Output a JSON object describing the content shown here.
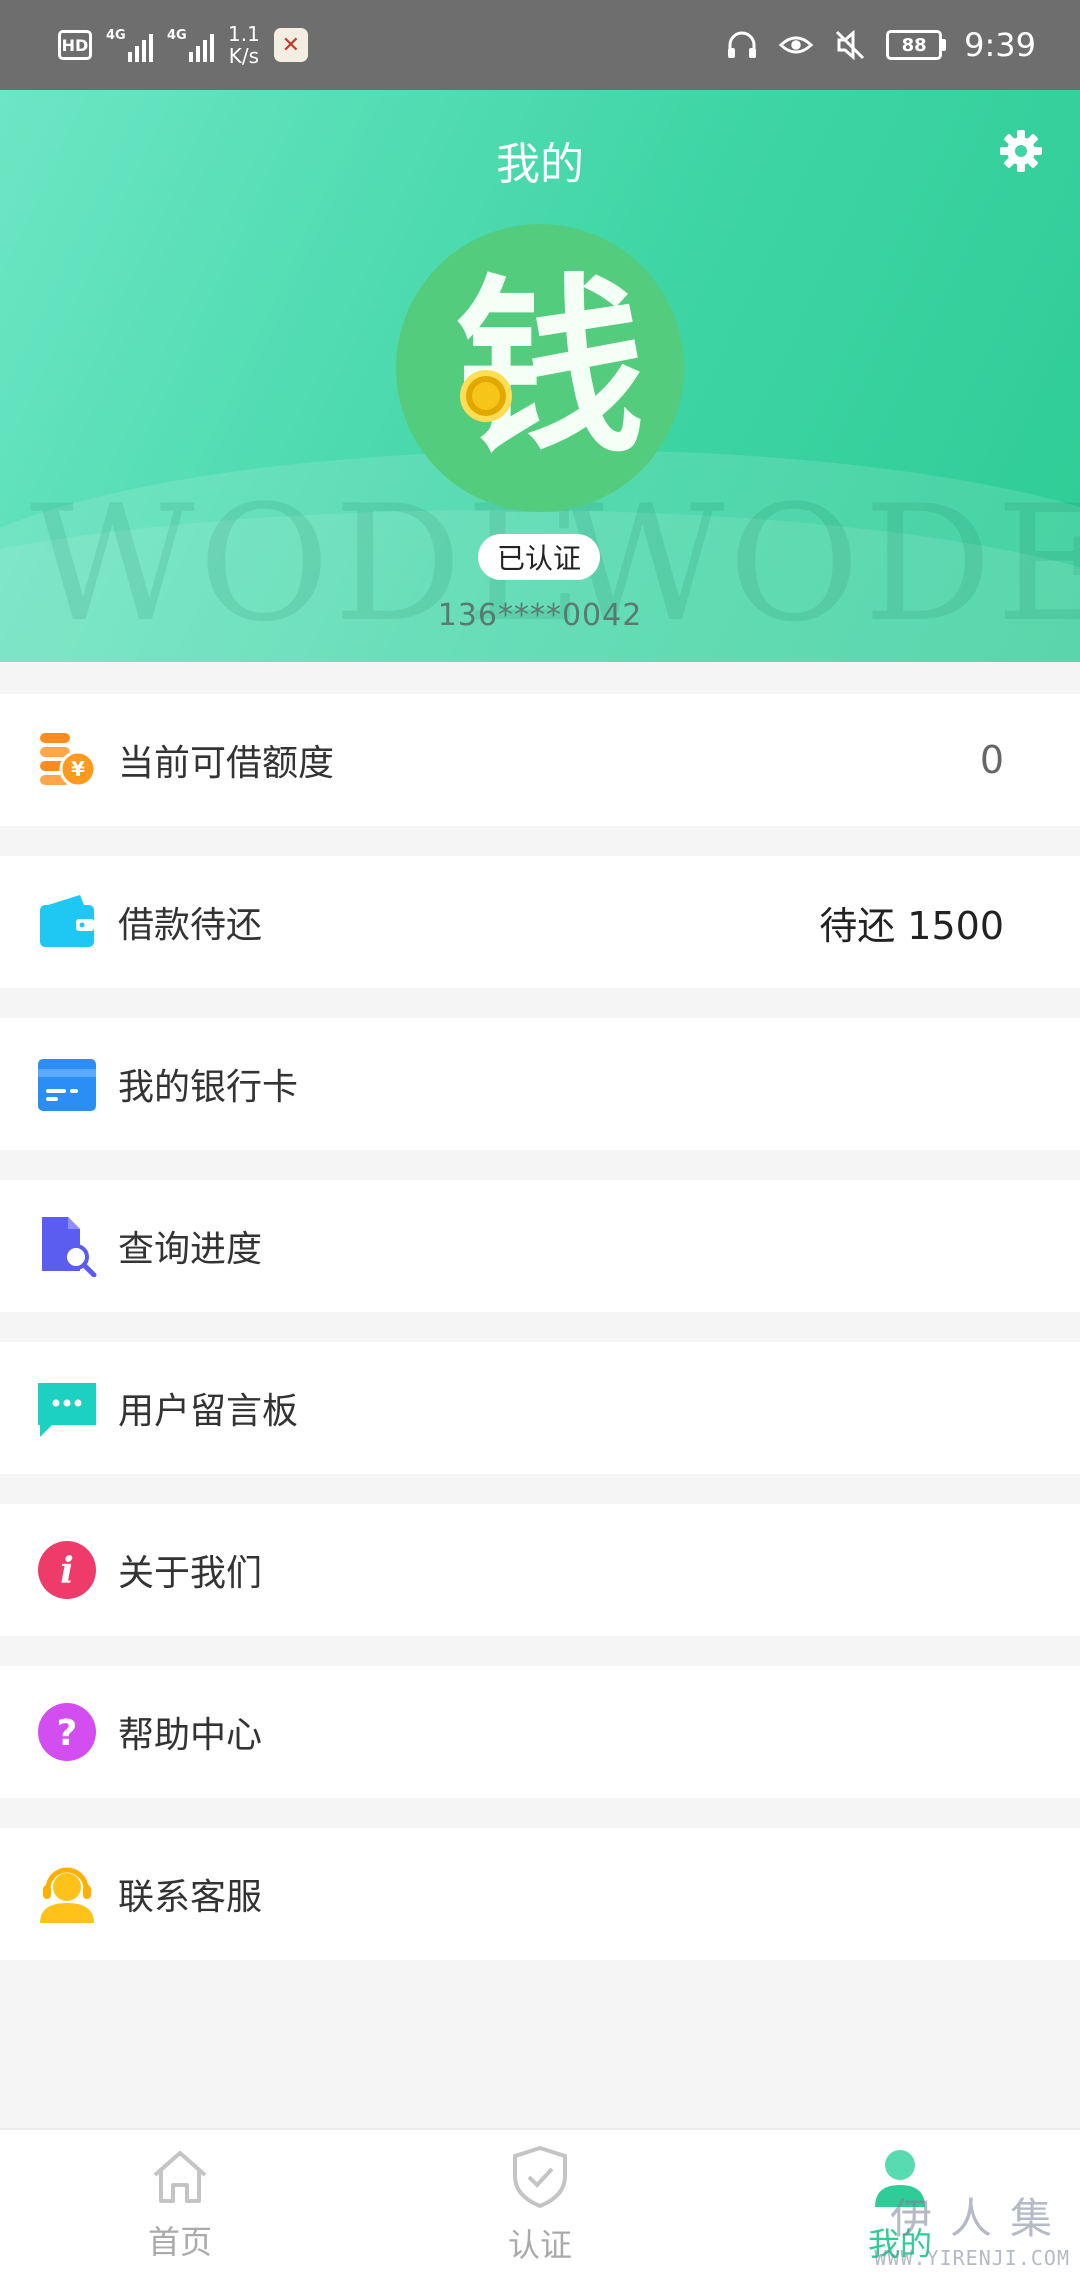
{
  "status_bar": {
    "hd": "HD",
    "net1": "4G",
    "net2": "4G",
    "speed_value": "1.1",
    "speed_unit": "K/s",
    "battery": "88",
    "time": "9:39"
  },
  "header": {
    "title": "我的",
    "avatar_char": "钱",
    "watermark_text": "WODE",
    "verified_badge": "已认证",
    "phone": "136****0042"
  },
  "menu": [
    {
      "label": "当前可借额度",
      "value": "0",
      "icon": "coin-stack-icon",
      "color": "#ff8a1f"
    },
    {
      "label": "借款待还",
      "value": "待还 1500",
      "icon": "wallet-icon",
      "color": "#1ec8f2"
    },
    {
      "label": "我的银行卡",
      "value": "",
      "icon": "bank-card-icon",
      "color": "#2b8ef5"
    },
    {
      "label": "查询进度",
      "value": "",
      "icon": "document-search-icon",
      "color": "#5b5cf0"
    },
    {
      "label": "用户留言板",
      "value": "",
      "icon": "message-board-icon",
      "color": "#1dd1c0"
    },
    {
      "label": "关于我们",
      "value": "",
      "icon": "info-icon",
      "color": "#ee3b6a"
    },
    {
      "label": "帮助中心",
      "value": "",
      "icon": "help-icon",
      "color": "#d24ef0"
    },
    {
      "label": "联系客服",
      "value": "",
      "icon": "customer-service-icon",
      "color": "#ffc21a"
    }
  ],
  "tabs": [
    {
      "label": "首页",
      "icon": "home-icon"
    },
    {
      "label": "认证",
      "icon": "shield-check-icon"
    },
    {
      "label": "我的",
      "icon": "user-icon",
      "active": true
    }
  ],
  "watermark": {
    "chars": "伊人集",
    "url": "WWW.YIRENJI.COM"
  },
  "colors": {
    "accent": "#2ecc96",
    "header_gradient_start": "#6ce6c4",
    "header_gradient_end": "#2ecc96",
    "status_bar": "#6e6e6e"
  }
}
